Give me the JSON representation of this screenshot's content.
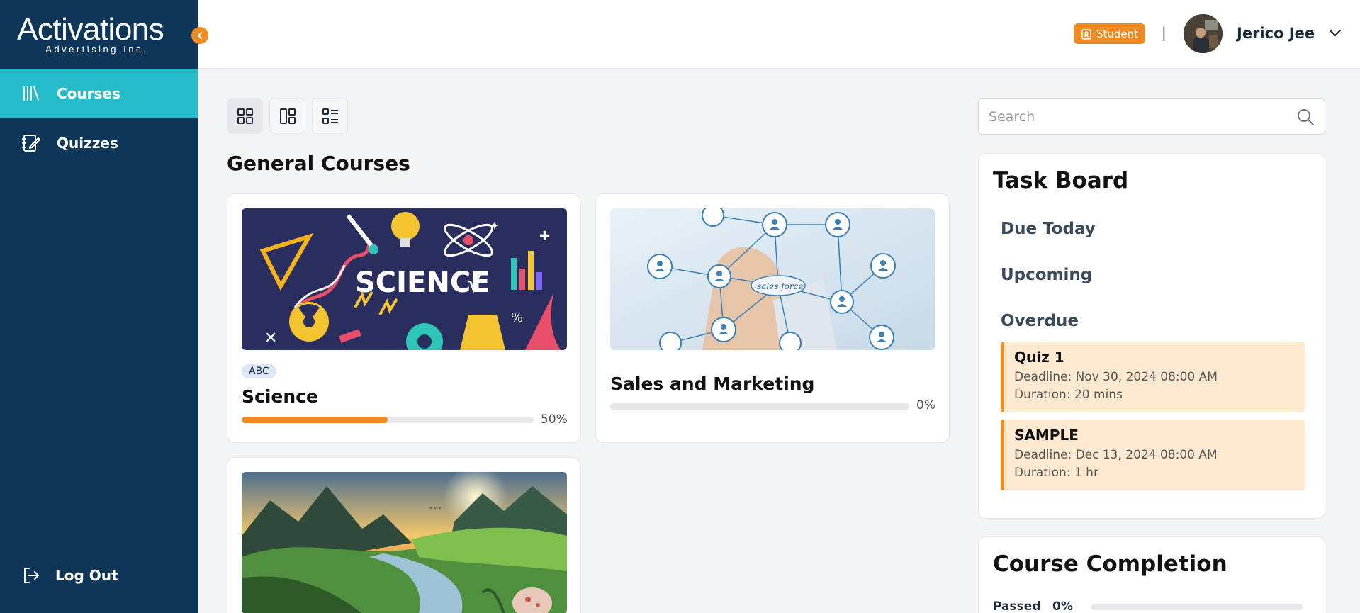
{
  "brand": {
    "name": "Activations",
    "tagline": "Advertising Inc."
  },
  "sidebar": {
    "items": [
      {
        "label": "Courses",
        "icon": "library-icon",
        "active": true
      },
      {
        "label": "Quizzes",
        "icon": "notebook-edit-icon",
        "active": false
      }
    ],
    "logout_label": "Log Out"
  },
  "header": {
    "role_badge": "Student",
    "divider": "|",
    "user_name": "Jerico Jee"
  },
  "section_title": "General Courses",
  "courses": [
    {
      "tag": "ABC",
      "title": "Science",
      "progress_text": "50%",
      "progress": 0.5,
      "image": "science-doodle-image"
    },
    {
      "title": "Sales and Marketing",
      "progress_text": "0%",
      "progress": 0,
      "image": "network-diagram-image"
    },
    {
      "image": "landscape-image"
    }
  ],
  "search": {
    "placeholder": "Search",
    "value": ""
  },
  "task_board": {
    "title": "Task Board",
    "sections": [
      "Due Today",
      "Upcoming",
      "Overdue"
    ],
    "tasks": [
      {
        "name": "Quiz 1",
        "deadline": "Deadline: Nov 30, 2024 08:00 AM",
        "duration": "Duration: 20 mins"
      },
      {
        "name": "SAMPLE",
        "deadline": "Deadline: Dec 13, 2024 08:00 AM",
        "duration": "Duration: 1 hr"
      }
    ]
  },
  "course_completion": {
    "title": "Course Completion",
    "rows": [
      {
        "label": "Passed",
        "value": "0%",
        "progress": 0
      }
    ]
  },
  "colors": {
    "sidebar": "#0e3658",
    "accent": "#f08a24",
    "active_nav": "#26bbc8",
    "task_bg": "#fde9cf"
  }
}
